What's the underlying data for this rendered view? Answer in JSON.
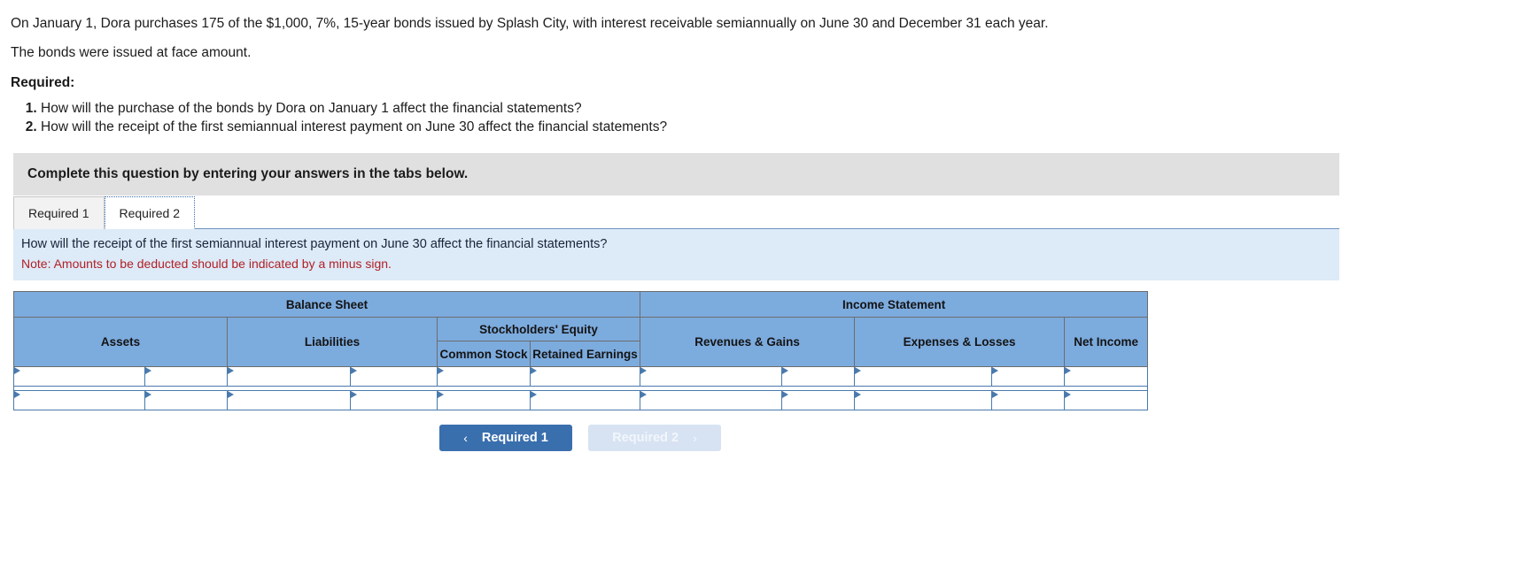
{
  "problem": {
    "paragraph1": "On January 1, Dora purchases 175 of the $1,000, 7%, 15-year bonds issued by Splash City, with interest receivable semiannually on June 30 and December 31 each year.",
    "paragraph2": "The bonds were issued at face amount.",
    "required_label": "Required:",
    "requirements": [
      "How will the purchase of the bonds by Dora on January 1 affect the financial statements?",
      "How will the receipt of the first semiannual interest payment on June 30 affect the financial statements?"
    ]
  },
  "instruction_band": {
    "text": "Complete this question by entering your answers in the tabs below."
  },
  "tabs": [
    {
      "label": "Required 1",
      "active": false
    },
    {
      "label": "Required 2",
      "active": true
    }
  ],
  "question_band": {
    "question": "How will the receipt of the first semiannual interest payment on June 30 affect the financial statements?",
    "note": "Note: Amounts to be deducted should be indicated by a minus sign."
  },
  "table": {
    "group_headers": [
      {
        "label": "Balance Sheet",
        "colspan": 8
      },
      {
        "label": "Income Statement",
        "colspan": 6
      }
    ],
    "columns": [
      {
        "label": "Assets"
      },
      {
        "label": "Liabilities"
      },
      {
        "label": "Stockholders' Equity",
        "children": [
          "Common Stock",
          "Retained Earnings"
        ]
      },
      {
        "label": "Revenues & Gains"
      },
      {
        "label": "Expenses & Losses"
      },
      {
        "label": "Net Income"
      }
    ],
    "column_labels": {
      "assets": "Assets",
      "liabilities": "Liabilities",
      "stockholders_equity": "Stockholders' Equity",
      "common_stock": "Common Stock",
      "retained_earnings": "Retained Earnings",
      "revenues_gains": "Revenues & Gains",
      "expenses_losses": "Expenses & Losses",
      "net_income": "Net Income"
    },
    "rows": [
      {
        "assets_label": "",
        "assets_value": "",
        "liabilities_label": "",
        "liabilities_value": "",
        "common_stock": "",
        "retained_earnings": "",
        "revenues_label": "",
        "revenues_value": "",
        "expenses_label": "",
        "expenses_value": "",
        "net_income": ""
      },
      {
        "assets_label": "",
        "assets_value": "",
        "liabilities_label": "",
        "liabilities_value": "",
        "common_stock": "",
        "retained_earnings": "",
        "revenues_label": "",
        "revenues_value": "",
        "expenses_label": "",
        "expenses_value": "",
        "net_income": ""
      }
    ]
  },
  "nav": {
    "prev": {
      "label": "Required 1",
      "icon": "chevron-left",
      "glyph": "‹"
    },
    "next": {
      "label": "Required 2",
      "icon": "chevron-right",
      "glyph": "›"
    }
  },
  "colors": {
    "header_blue": "#7cabde",
    "table_border": "#4a7aac",
    "band_grey": "#e0e0e0",
    "band_blue": "#ddeaf7",
    "note_red": "#b12027",
    "button_primary": "#3a6fae",
    "button_disabled": "#d7e3f2"
  }
}
